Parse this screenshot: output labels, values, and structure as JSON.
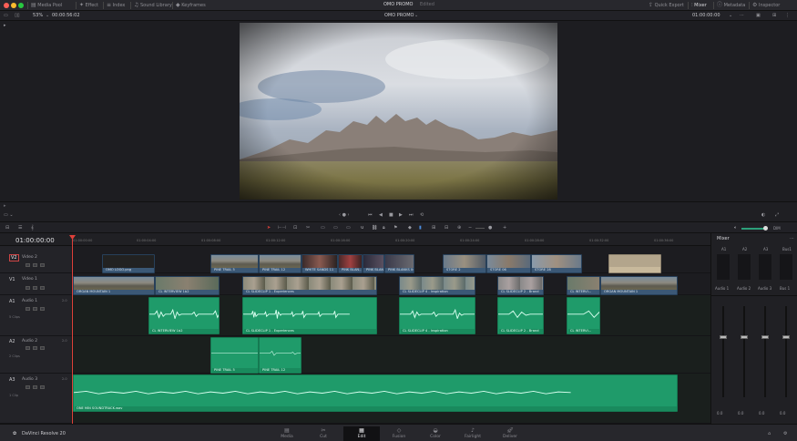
{
  "topbar": {
    "menu": [
      "Media Pool",
      "Effect",
      "Index",
      "Sound Library",
      "Keyframes"
    ],
    "project_title": "OMO PROMO",
    "project_status": "Edited",
    "right": [
      "Quick Export",
      "Mixer",
      "Metadata",
      "Inspector"
    ]
  },
  "viewer_toolbar": {
    "zoom": "53%",
    "source_timecode": "00:00:56:02",
    "timeline_name": "OMO PROMO",
    "record_timecode": "01:00:00:00"
  },
  "timeline_toolbar": {
    "volume_label": "DIM"
  },
  "timeline": {
    "timecode": "01:00:00:00",
    "ruler": [
      "01:00:00:00",
      "01:00:04:00",
      "01:00:08:00",
      "01:00:12:00",
      "01:00:16:00",
      "01:00:20:00",
      "01:00:24:00",
      "01:00:28:00",
      "01:00:32:00",
      "01:00:36:00"
    ],
    "tracks": [
      {
        "id": "V2",
        "name": "Video 2",
        "clips_label": ""
      },
      {
        "id": "V1",
        "name": "Video 1",
        "clips_label": ""
      },
      {
        "id": "A1",
        "name": "Audio 1",
        "level": "2.0",
        "clips_label": "5 Clips"
      },
      {
        "id": "A2",
        "name": "Audio 2",
        "level": "2.0",
        "clips_label": "2 Clips"
      },
      {
        "id": "A3",
        "name": "Audio 3",
        "level": "2.0",
        "clips_label": "1 Clip"
      }
    ],
    "v2_clips": [
      "OMO LOGO.png",
      "PINE TRAIL 5",
      "PINE TRAIL 12",
      "WHITE SANDS 11",
      "PINK BLAN...",
      "PINK BLANK...",
      "PINK BLANKS 04",
      "STORE 2",
      "STORE 06",
      "STORE 28",
      ""
    ],
    "v1_clips": [
      "ORGAN MOUNTAIN 1",
      "CL INTERVIEW 1b2",
      "CL SLIDECLIP 1 - Experiences",
      "CL SLIDECLIP 4 - Inspiration",
      "CL SLIDECLIP 2 - Brand",
      "CL INTERVI...",
      "ORGAN MOUNTAIN 1"
    ],
    "a1_clips": [
      "CL INTERVIEW 1b2",
      "CL SLIDECLIP 1 - Experiences",
      "CL SLIDECLIP 4 - Inspiration",
      "CL SLIDECLIP 2 - Brand",
      "CL INTERVI..."
    ],
    "a2_clips": [
      "PINE TRAIL 5",
      "PINE TRAIL 12"
    ],
    "a3_clips": [
      "ONE MIN SOUNDTRACK.wav"
    ]
  },
  "mixer": {
    "title": "Mixer",
    "channels": [
      "A1",
      "A2",
      "A3",
      "Bus1"
    ],
    "channel_labels": [
      "Audio 1",
      "Audio 2",
      "Audio 3",
      "Bus 1"
    ],
    "fader_values": [
      "0.0",
      "0.0",
      "0.0",
      "0.0"
    ]
  },
  "bottombar": {
    "app_name": "DaVinci Resolve 20",
    "pages": [
      "Media",
      "Cut",
      "Edit",
      "Fusion",
      "Color",
      "Fairlight",
      "Deliver"
    ],
    "active_page": "Edit"
  },
  "colors": {
    "video_clip": "#3b5876",
    "audio_clip": "#1f9b6a",
    "playhead": "#e0403a",
    "background": "#1b1b1f"
  }
}
